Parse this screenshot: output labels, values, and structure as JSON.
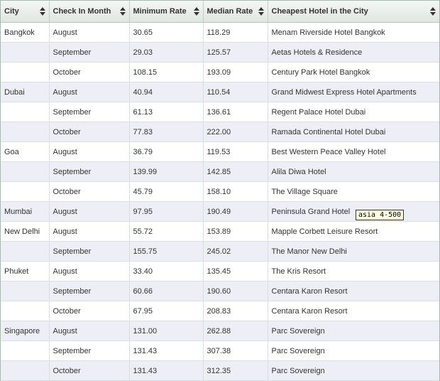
{
  "table": {
    "columns": [
      "City",
      "Check In Month",
      "Minimum Rate",
      "Median Rate",
      "Cheapest Hotel in the City"
    ],
    "rows": [
      {
        "city": "Bangkok",
        "month": "August",
        "min": "30.65",
        "median": "118.29",
        "hotel": "Menam Riverside Hotel Bangkok"
      },
      {
        "city": "",
        "month": "September",
        "min": "29.03",
        "median": "125.57",
        "hotel": "Aetas Hotels & Residence"
      },
      {
        "city": "",
        "month": "October",
        "min": "108.15",
        "median": "193.09",
        "hotel": "Century Park Hotel Bangkok"
      },
      {
        "city": "Dubai",
        "month": "August",
        "min": "40.94",
        "median": "110.54",
        "hotel": "Grand Midwest Express Hotel Apartments"
      },
      {
        "city": "",
        "month": "September",
        "min": "61.13",
        "median": "136.61",
        "hotel": "Regent Palace Hotel Dubai"
      },
      {
        "city": "",
        "month": "October",
        "min": "77.83",
        "median": "222.00",
        "hotel": "Ramada Continental Hotel Dubai"
      },
      {
        "city": "Goa",
        "month": "August",
        "min": "36.79",
        "median": "119.53",
        "hotel": "Best Western Peace Valley Hotel"
      },
      {
        "city": "",
        "month": "September",
        "min": "139.99",
        "median": "142.85",
        "hotel": "Alila Diwa Hotel"
      },
      {
        "city": "",
        "month": "October",
        "min": "45.79",
        "median": "158.10",
        "hotel": "The Village Square"
      },
      {
        "city": "Mumbai",
        "month": "August",
        "min": "97.95",
        "median": "190.49",
        "hotel": "Peninsula Grand Hotel"
      },
      {
        "city": "New Delhi",
        "month": "August",
        "min": "55.72",
        "median": "153.89",
        "hotel": "Mapple Corbett Leisure Resort"
      },
      {
        "city": "",
        "month": "September",
        "min": "155.75",
        "median": "245.02",
        "hotel": "The Manor New Delhi"
      },
      {
        "city": "Phuket",
        "month": "August",
        "min": "33.40",
        "median": "135.45",
        "hotel": "The Kris Resort"
      },
      {
        "city": "",
        "month": "September",
        "min": "60.66",
        "median": "190.60",
        "hotel": "Centara Karon Resort"
      },
      {
        "city": "",
        "month": "October",
        "min": "67.95",
        "median": "208.83",
        "hotel": "Centara Karon Resort"
      },
      {
        "city": "Singapore",
        "month": "August",
        "min": "131.00",
        "median": "262.88",
        "hotel": "Parc Sovereign"
      },
      {
        "city": "",
        "month": "September",
        "min": "131.43",
        "median": "307.38",
        "hotel": "Parc Sovereign"
      },
      {
        "city": "",
        "month": "October",
        "min": "131.43",
        "median": "312.35",
        "hotel": "Parc Sovereign"
      }
    ]
  },
  "tooltip": {
    "text": "asia 4-500"
  },
  "icons": {
    "sort": "sort-arrows-icon"
  }
}
